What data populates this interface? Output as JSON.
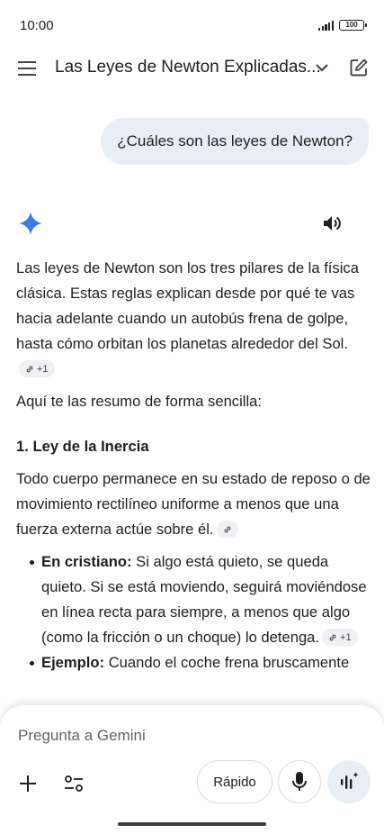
{
  "status_bar": {
    "time": "10:00",
    "battery": "100",
    "icons": [
      "signal-icon",
      "battery-icon"
    ]
  },
  "header": {
    "title": "Las Leyes de Newton Explicadas...",
    "icons": [
      "menu-icon",
      "chevron-down-icon",
      "edit-icon"
    ]
  },
  "conversation": {
    "user_message": "¿Cuáles son las leyes de Newton?",
    "response_icons": [
      "gemini-sparkle-icon",
      "speaker-icon"
    ],
    "intro": "Las leyes de Newton son los tres pilares de la física clásica. Estas reglas explican desde por qué te vas hacia adelante cuando un autobús frena de golpe, hasta cómo orbitan los planetas alrededor del Sol.",
    "intro_chip": "+1",
    "summary": "Aquí te las resumo de forma sencilla:",
    "section_1": {
      "heading": "1. Ley de la Inercia",
      "body": "Todo cuerpo permanece en su estado de reposo o de movimiento rectilíneo uniforme a menos que una fuerza externa actúe sobre él.",
      "bullets": [
        {
          "label": "En cristiano:",
          "text": " Si algo está quieto, se queda quieto. Si se está moviendo, seguirá moviéndose en línea recta para siempre, a menos que algo (como la fricción o un choque) lo detenga.",
          "chip": "+1"
        },
        {
          "label": "Ejemplo:",
          "text": " Cuando el coche frena bruscamente"
        }
      ]
    }
  },
  "input_bar": {
    "placeholder": "Pregunta a Gemini",
    "model_label": "Rápido",
    "icons": [
      "plus-icon",
      "tools-icon",
      "microphone-icon",
      "live-mode-icon"
    ]
  },
  "colors": {
    "user_bubble": "#e9eef6",
    "live_button": "#e8eef7",
    "gemini_blue": "#4285f4"
  }
}
